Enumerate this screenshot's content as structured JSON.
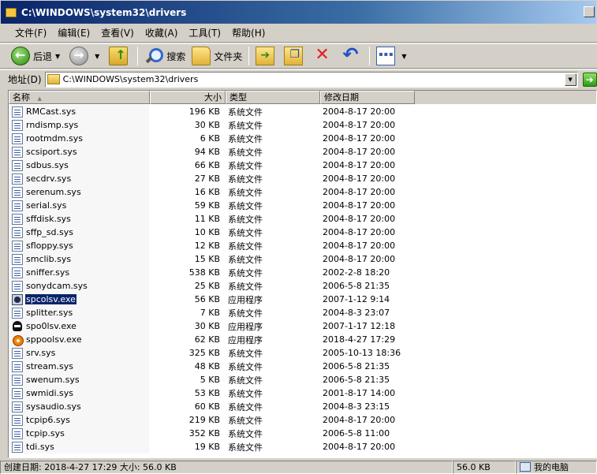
{
  "window": {
    "title": "C:\\WINDOWS\\system32\\drivers"
  },
  "menu": [
    "文件(F)",
    "编辑(E)",
    "查看(V)",
    "收藏(A)",
    "工具(T)",
    "帮助(H)"
  ],
  "toolbar": {
    "back_label": "后退",
    "search_label": "搜索",
    "folders_label": "文件夹"
  },
  "address": {
    "label": "地址(D)",
    "value": "C:\\WINDOWS\\system32\\drivers"
  },
  "columns": {
    "name": "名称",
    "size": "大小",
    "type": "类型",
    "modified": "修改日期"
  },
  "files": [
    {
      "name": "RMCast.sys",
      "size": "196 KB",
      "type": "系统文件",
      "modified": "2004-8-17 20:00",
      "icon": "sys-file-icon"
    },
    {
      "name": "rndismp.sys",
      "size": "30 KB",
      "type": "系统文件",
      "modified": "2004-8-17 20:00",
      "icon": "sys-file-icon"
    },
    {
      "name": "rootmdm.sys",
      "size": "6 KB",
      "type": "系统文件",
      "modified": "2004-8-17 20:00",
      "icon": "sys-file-icon"
    },
    {
      "name": "scsiport.sys",
      "size": "94 KB",
      "type": "系统文件",
      "modified": "2004-8-17 20:00",
      "icon": "sys-file-icon"
    },
    {
      "name": "sdbus.sys",
      "size": "66 KB",
      "type": "系统文件",
      "modified": "2004-8-17 20:00",
      "icon": "sys-file-icon"
    },
    {
      "name": "secdrv.sys",
      "size": "27 KB",
      "type": "系统文件",
      "modified": "2004-8-17 20:00",
      "icon": "sys-file-icon"
    },
    {
      "name": "serenum.sys",
      "size": "16 KB",
      "type": "系统文件",
      "modified": "2004-8-17 20:00",
      "icon": "sys-file-icon"
    },
    {
      "name": "serial.sys",
      "size": "59 KB",
      "type": "系统文件",
      "modified": "2004-8-17 20:00",
      "icon": "sys-file-icon"
    },
    {
      "name": "sffdisk.sys",
      "size": "11 KB",
      "type": "系统文件",
      "modified": "2004-8-17 20:00",
      "icon": "sys-file-icon"
    },
    {
      "name": "sffp_sd.sys",
      "size": "10 KB",
      "type": "系统文件",
      "modified": "2004-8-17 20:00",
      "icon": "sys-file-icon"
    },
    {
      "name": "sfloppy.sys",
      "size": "12 KB",
      "type": "系统文件",
      "modified": "2004-8-17 20:00",
      "icon": "sys-file-icon"
    },
    {
      "name": "smclib.sys",
      "size": "15 KB",
      "type": "系统文件",
      "modified": "2004-8-17 20:00",
      "icon": "sys-file-icon"
    },
    {
      "name": "sniffer.sys",
      "size": "538 KB",
      "type": "系统文件",
      "modified": "2002-2-8 18:20",
      "icon": "sys-file-icon"
    },
    {
      "name": "sonydcam.sys",
      "size": "25 KB",
      "type": "系统文件",
      "modified": "2006-5-8 21:35",
      "icon": "sys-file-icon"
    },
    {
      "name": "spcolsv.exe",
      "size": "56 KB",
      "type": "应用程序",
      "modified": "2007-1-12 9:14",
      "icon": "exe-app-icon",
      "selected": true
    },
    {
      "name": "splitter.sys",
      "size": "7 KB",
      "type": "系统文件",
      "modified": "2004-8-3 23:07",
      "icon": "sys-file-icon"
    },
    {
      "name": "spo0lsv.exe",
      "size": "30 KB",
      "type": "应用程序",
      "modified": "2007-1-17 12:18",
      "icon": "spy-app-icon"
    },
    {
      "name": "sppoolsv.exe",
      "size": "62 KB",
      "type": "应用程序",
      "modified": "2018-4-27 17:29",
      "icon": "gear-app-icon"
    },
    {
      "name": "srv.sys",
      "size": "325 KB",
      "type": "系统文件",
      "modified": "2005-10-13 18:36",
      "icon": "sys-file-icon"
    },
    {
      "name": "stream.sys",
      "size": "48 KB",
      "type": "系统文件",
      "modified": "2006-5-8 21:35",
      "icon": "sys-file-icon"
    },
    {
      "name": "swenum.sys",
      "size": "5 KB",
      "type": "系统文件",
      "modified": "2006-5-8 21:35",
      "icon": "sys-file-icon"
    },
    {
      "name": "swmidi.sys",
      "size": "53 KB",
      "type": "系统文件",
      "modified": "2001-8-17 14:00",
      "icon": "sys-file-icon"
    },
    {
      "name": "sysaudio.sys",
      "size": "60 KB",
      "type": "系统文件",
      "modified": "2004-8-3 23:15",
      "icon": "sys-file-icon"
    },
    {
      "name": "tcpip6.sys",
      "size": "219 KB",
      "type": "系统文件",
      "modified": "2004-8-17 20:00",
      "icon": "sys-file-icon"
    },
    {
      "name": "tcpip.sys",
      "size": "352 KB",
      "type": "系统文件",
      "modified": "2006-5-8 11:00",
      "icon": "sys-file-icon"
    },
    {
      "name": "tdi.sys",
      "size": "19 KB",
      "type": "系统文件",
      "modified": "2004-8-17 20:00",
      "icon": "sys-file-icon"
    }
  ],
  "status": {
    "details": "创建日期: 2018-4-27 17:29 大小: 56.0 KB",
    "size": "56.0 KB",
    "zone": "我的电脑"
  },
  "colors": {
    "title_active": "#0a246a",
    "selection": "#0a246a",
    "face": "#d4d0c8"
  }
}
